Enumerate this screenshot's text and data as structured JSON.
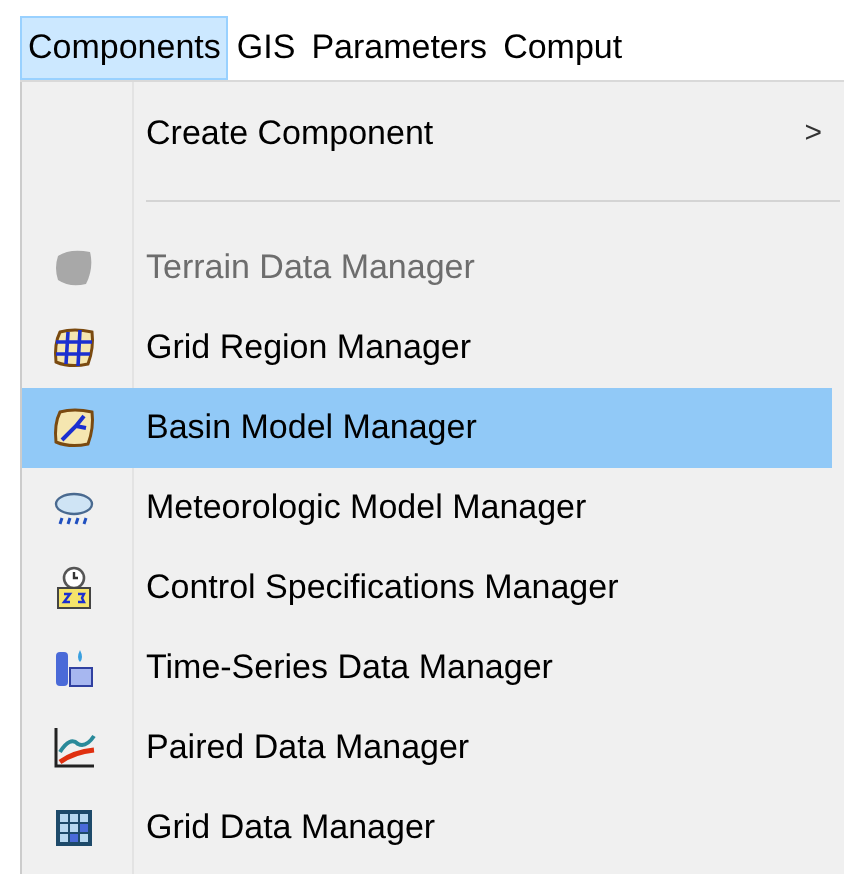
{
  "menu_bar": [
    {
      "label": "Components",
      "selected": true
    },
    {
      "label": "GIS",
      "selected": false
    },
    {
      "label": "Parameters",
      "selected": false
    },
    {
      "label": "Comput",
      "selected": false
    }
  ],
  "menu": {
    "items": [
      {
        "kind": "submenu",
        "label": "Create Component",
        "arrow": ">"
      },
      {
        "kind": "separator"
      },
      {
        "kind": "item",
        "label": "Terrain Data Manager",
        "disabled": true,
        "selected": false
      },
      {
        "kind": "item",
        "label": "Grid Region Manager",
        "disabled": false,
        "selected": false
      },
      {
        "kind": "item",
        "label": "Basin Model Manager",
        "disabled": false,
        "selected": true
      },
      {
        "kind": "item",
        "label": "Meteorologic Model Manager",
        "disabled": false,
        "selected": false
      },
      {
        "kind": "item",
        "label": "Control Specifications Manager",
        "disabled": false,
        "selected": false
      },
      {
        "kind": "item",
        "label": "Time-Series Data Manager",
        "disabled": false,
        "selected": false
      },
      {
        "kind": "item",
        "label": "Paired Data Manager",
        "disabled": false,
        "selected": false
      },
      {
        "kind": "item",
        "label": "Grid Data Manager",
        "disabled": false,
        "selected": false
      }
    ]
  }
}
